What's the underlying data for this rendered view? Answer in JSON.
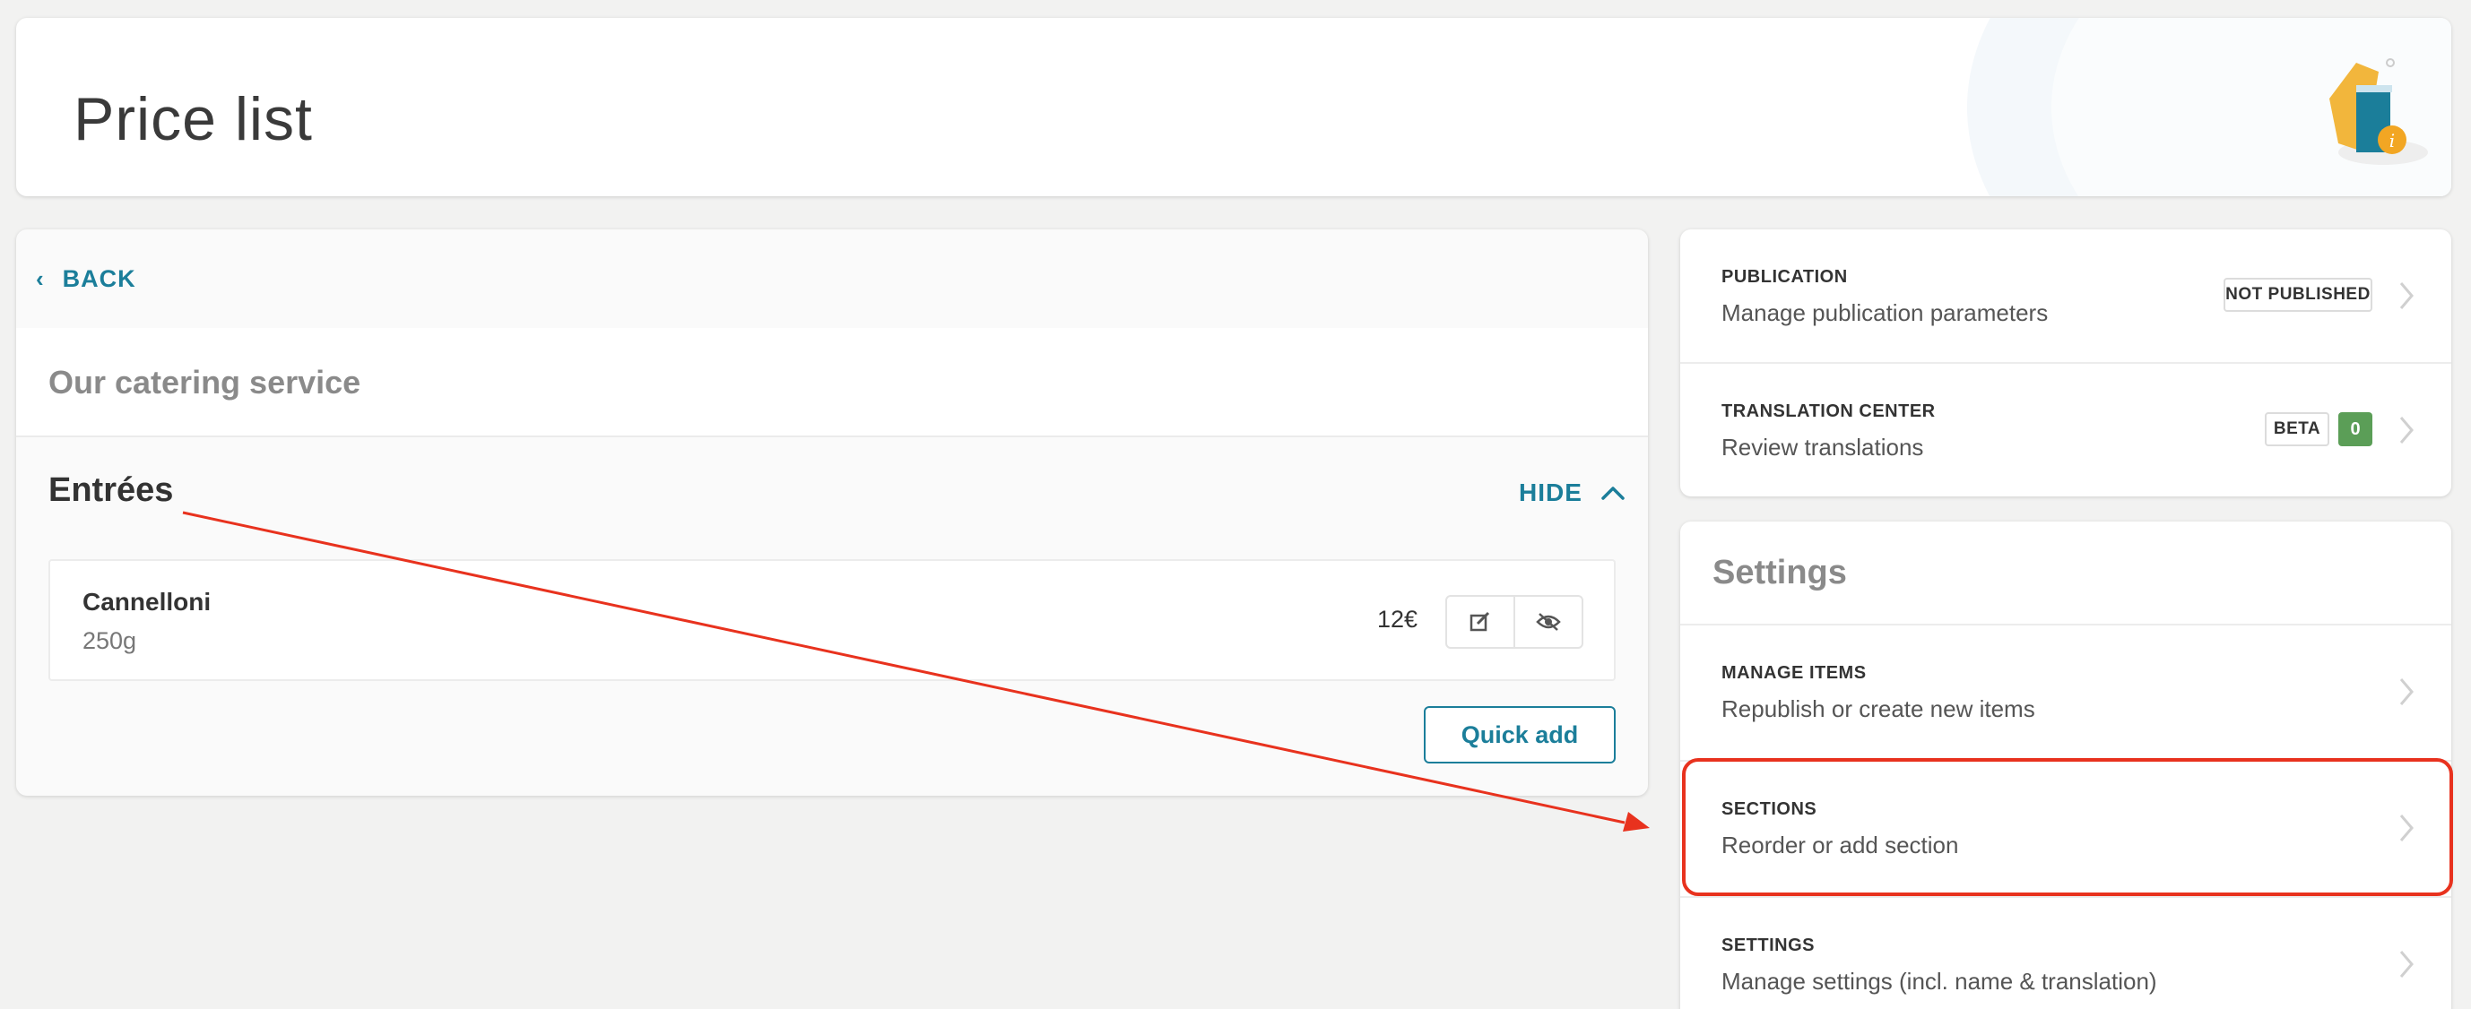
{
  "header": {
    "title": "Price list",
    "logo_icon": "price-tag-info-icon"
  },
  "left": {
    "back_label": "BACK",
    "menu_name": "Our catering service",
    "section": {
      "name": "Entrées",
      "toggle_label": "HIDE",
      "items": [
        {
          "name": "Cannelloni",
          "detail": "250g",
          "price": "12€"
        }
      ],
      "quick_add_label": "Quick add"
    }
  },
  "right": {
    "publication": {
      "label": "PUBLICATION",
      "desc": "Manage publication parameters",
      "badge": "NOT PUBLISHED"
    },
    "translation": {
      "label": "TRANSLATION CENTER",
      "desc": "Review translations",
      "badge": "BETA",
      "count": "0"
    },
    "settings_title": "Settings",
    "rows": [
      {
        "label": "MANAGE ITEMS",
        "desc": "Republish or create new items"
      },
      {
        "label": "SECTIONS",
        "desc": "Reorder or add section"
      },
      {
        "label": "SETTINGS",
        "desc": "Manage settings (incl. name & translation)"
      }
    ]
  },
  "colors": {
    "accent": "#1b7e9a",
    "annotation": "#e8321e",
    "count_badge": "#5b9e57"
  }
}
